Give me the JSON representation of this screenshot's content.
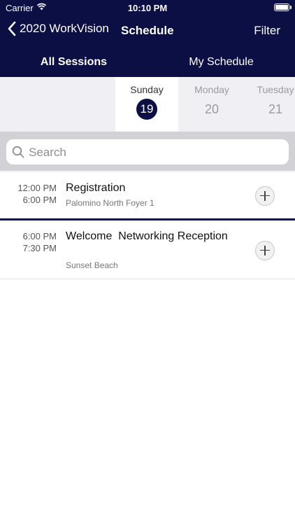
{
  "status_bar": {
    "carrier": "Carrier",
    "time": "10:10 PM"
  },
  "nav": {
    "back_label": "2020 WorkVision",
    "title": "Schedule",
    "filter_label": "Filter"
  },
  "tabs": [
    {
      "label": "All Sessions",
      "active": true
    },
    {
      "label": "My Schedule",
      "active": false
    }
  ],
  "days": [
    {
      "name": "Sunday",
      "date": "19",
      "selected": true
    },
    {
      "name": "Monday",
      "date": "20",
      "selected": false
    },
    {
      "name": "Tuesday",
      "date": "21",
      "selected": false
    }
  ],
  "search": {
    "placeholder": "Search",
    "value": ""
  },
  "sessions": [
    {
      "start": "12:00 PM",
      "end": "6:00 PM",
      "title": "Registration",
      "location": "Palomino North Foyer 1"
    },
    {
      "start": "6:00 PM",
      "end": "7:30 PM",
      "title": "Welcome  Networking Reception",
      "location": "Sunset Beach"
    }
  ],
  "colors": {
    "navy": "#0b0f44",
    "day_bar_bg": "#efeff4",
    "search_bar_bg": "#d2d2d6"
  }
}
